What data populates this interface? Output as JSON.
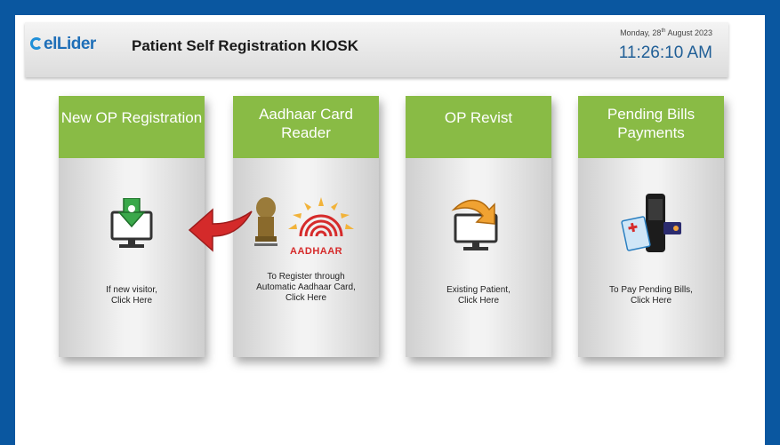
{
  "header": {
    "logo": "elLider",
    "title": "Patient Self Registration KIOSK",
    "date": "Monday, 28th August 2023",
    "time": "11:26:10 AM"
  },
  "cards": [
    {
      "title": "New OP Registration",
      "text": [
        "If new visitor,",
        "Click Here"
      ]
    },
    {
      "title": "Aadhaar Card Reader",
      "text": [
        "To Register through",
        "Automatic Aadhaar Card,",
        "Click Here"
      ],
      "badge": "AADHAAR"
    },
    {
      "title": "OP Revist",
      "text": [
        "Existing Patient,",
        "Click Here"
      ]
    },
    {
      "title": "Pending Bills Payments",
      "text": [
        "To Pay Pending Bills,",
        "Click Here"
      ]
    }
  ],
  "colors": {
    "frame": "#0a57a0",
    "card_header": "#89bb45",
    "arrow": "#d42a2a"
  },
  "icons": [
    "download-monitor-icon",
    "red-arrow-icon",
    "emblem-icon",
    "aadhaar-logo-icon",
    "revisit-monitor-icon",
    "payment-terminal-icon"
  ]
}
